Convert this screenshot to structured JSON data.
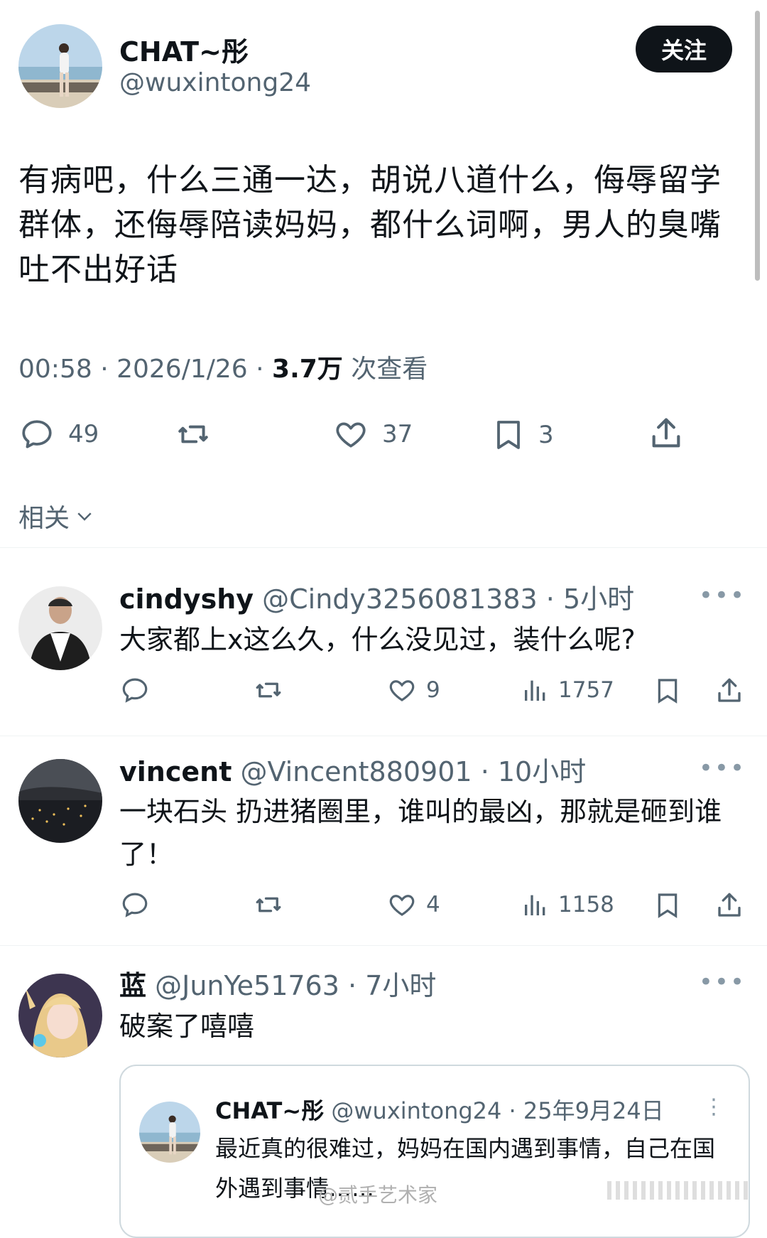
{
  "main_post": {
    "display_name": "CHAT~彤",
    "handle": "@wuxintong24",
    "follow_label": "关注",
    "text": "有病吧，什么三通一达，胡说八道什么，侮辱留学群体，还侮辱陪读妈妈，都什么词啊，男人的臭嘴吐不出好话",
    "time": "00:58",
    "date": "2026/1/26",
    "views": "3.7万",
    "views_label": "次查看",
    "replies": "49",
    "likes": "37",
    "bookmarks": "3"
  },
  "related_label": "相关",
  "comments": [
    {
      "name": "cindyshy",
      "handle": "@Cindy3256081383",
      "time": "5小时",
      "text": "大家都上x这么久，什么没见过，装什么呢?",
      "likes": "9",
      "views": "1757"
    },
    {
      "name": "vincent",
      "handle": "@Vincent880901",
      "time": "10小时",
      "text": "一块石头 扔进猪圈里，谁叫的最凶，那就是砸到谁了！",
      "likes": "4",
      "views": "1158"
    },
    {
      "name": "蓝",
      "handle": "@JunYe51763",
      "time": "7小时",
      "text": "破案了嘻嘻"
    }
  ],
  "quoted_post": {
    "name": "CHAT~彤",
    "handle": "@wuxintong24",
    "date": "25年9月24日",
    "text": "最近真的很难过，妈妈在国内遇到事情，自己在国外遇到事情……"
  },
  "watermark": "@贰手艺术家",
  "colors": {
    "text": "#0f1419",
    "muted": "#536471",
    "border": "#cfd9de",
    "button": "#0f1419"
  }
}
